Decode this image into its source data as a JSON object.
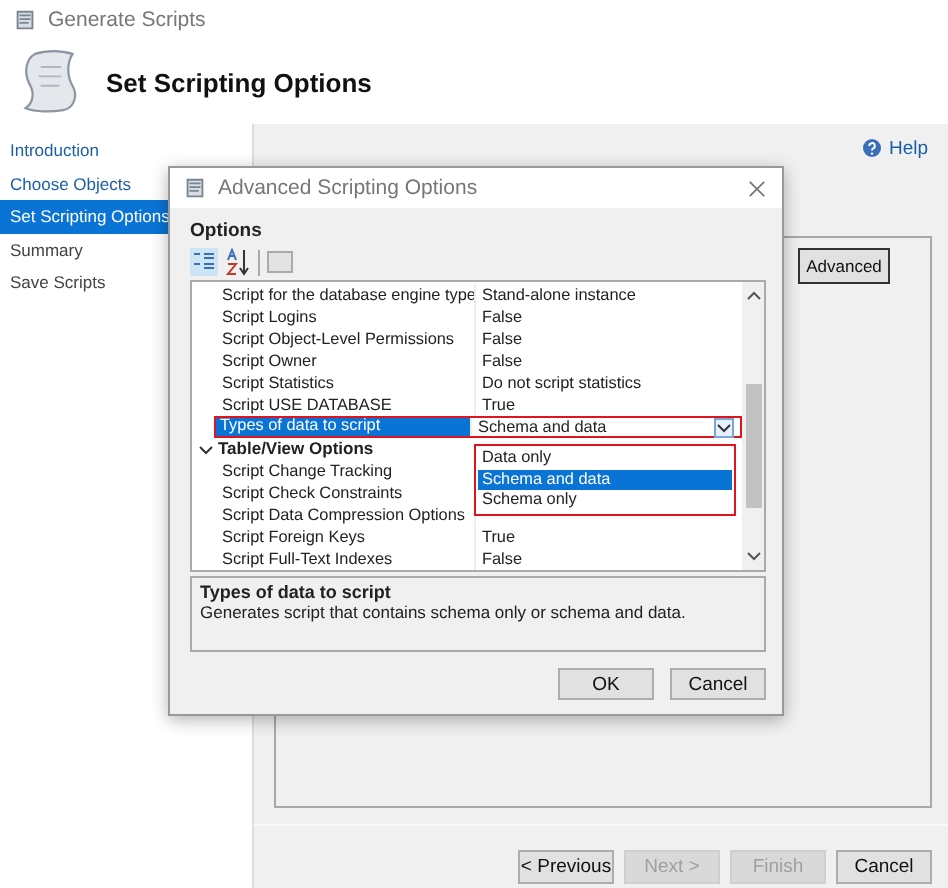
{
  "window": {
    "title": "Generate Scripts"
  },
  "header": {
    "title": "Set Scripting Options"
  },
  "nav": [
    {
      "label": "Introduction",
      "selected": false,
      "visited": true
    },
    {
      "label": "Choose Objects",
      "selected": false,
      "visited": true
    },
    {
      "label": "Set Scripting Options",
      "selected": true,
      "visited": true
    },
    {
      "label": "Summary",
      "selected": false,
      "visited": false
    },
    {
      "label": "Save Scripts",
      "selected": false,
      "visited": false
    }
  ],
  "help_link": "Help",
  "advanced_button": "Advanced",
  "wizard_buttons": [
    {
      "label": "< Previous",
      "disabled": false
    },
    {
      "label": "Next >",
      "disabled": true
    },
    {
      "label": "Finish",
      "disabled": true
    },
    {
      "label": "Cancel",
      "disabled": false
    }
  ],
  "dialog": {
    "title": "Advanced Scripting Options",
    "section_label": "Options",
    "properties": [
      {
        "kind": "property",
        "name": "Script for the database engine type",
        "value": "Stand-alone instance",
        "selected": false,
        "outlined": false
      },
      {
        "kind": "property",
        "name": "Script Logins",
        "value": "False",
        "selected": false,
        "outlined": false
      },
      {
        "kind": "property",
        "name": "Script Object-Level Permissions",
        "value": "False",
        "selected": false,
        "outlined": false
      },
      {
        "kind": "property",
        "name": "Script Owner",
        "value": "False",
        "selected": false,
        "outlined": false
      },
      {
        "kind": "property",
        "name": "Script Statistics",
        "value": "Do not script statistics",
        "selected": false,
        "outlined": false
      },
      {
        "kind": "property",
        "name": "Script USE DATABASE",
        "value": "True",
        "selected": false,
        "outlined": false
      },
      {
        "kind": "property",
        "name": "Types of data to script",
        "value": "Schema and data",
        "selected": true,
        "outlined": true
      },
      {
        "kind": "category",
        "name": "Table/View Options",
        "expanded": true
      },
      {
        "kind": "property",
        "name": "Script Change Tracking",
        "selected": false,
        "outlined": false
      },
      {
        "kind": "property",
        "name": "Script Check Constraints",
        "selected": false,
        "outlined": false
      },
      {
        "kind": "property",
        "name": "Script Data Compression Options",
        "selected": false,
        "outlined": false
      },
      {
        "kind": "property",
        "name": "Script Foreign Keys",
        "value": "True",
        "selected": false,
        "outlined": false
      },
      {
        "kind": "property",
        "name": "Script Full-Text Indexes",
        "value": "False",
        "selected": false,
        "outlined": false
      }
    ],
    "dropdown": {
      "outlined": true,
      "options": [
        {
          "label": "Data only",
          "selected": false
        },
        {
          "label": "Schema and data",
          "selected": true
        },
        {
          "label": "Schema only",
          "selected": false
        }
      ]
    },
    "description": {
      "title": "Types of data to script",
      "text": "Generates script that contains schema only or schema and data."
    },
    "buttons": [
      "OK",
      "Cancel"
    ]
  }
}
